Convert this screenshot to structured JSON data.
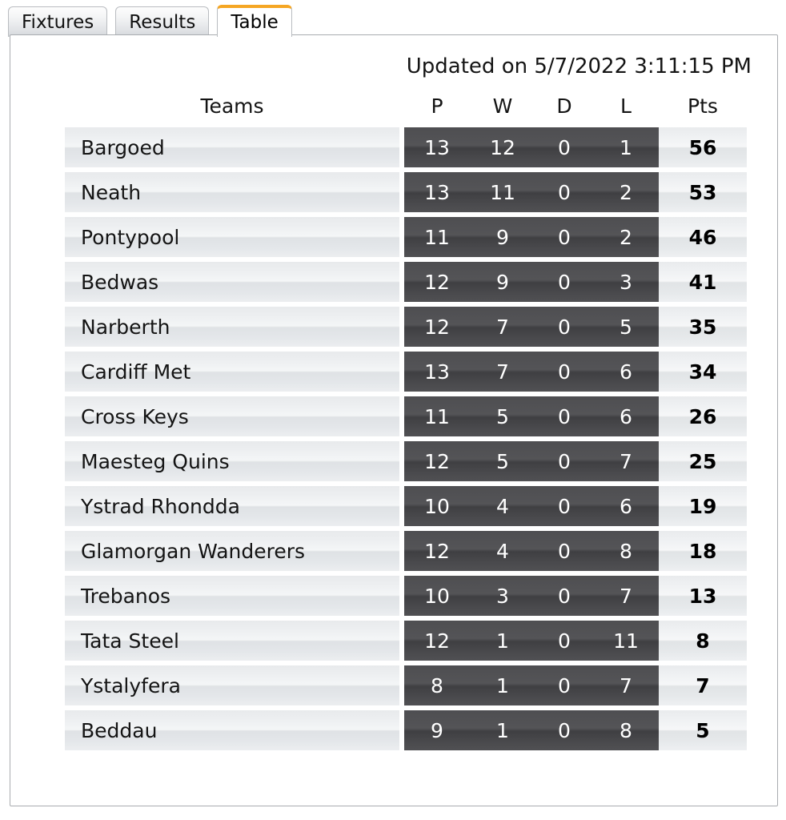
{
  "tabs": [
    {
      "label": "Fixtures",
      "active": false
    },
    {
      "label": "Results",
      "active": false
    },
    {
      "label": "Table",
      "active": true
    }
  ],
  "panel": {
    "updated_text": "Updated on 5/7/2022 3:11:15 PM"
  },
  "table": {
    "headers": {
      "team": "Teams",
      "played": "P",
      "won": "W",
      "drawn": "D",
      "lost": "L",
      "points": "Pts"
    },
    "rows": [
      {
        "team": "Bargoed",
        "p": "13",
        "w": "12",
        "d": "0",
        "l": "1",
        "pts": "56"
      },
      {
        "team": "Neath",
        "p": "13",
        "w": "11",
        "d": "0",
        "l": "2",
        "pts": "53"
      },
      {
        "team": "Pontypool",
        "p": "11",
        "w": "9",
        "d": "0",
        "l": "2",
        "pts": "46"
      },
      {
        "team": "Bedwas",
        "p": "12",
        "w": "9",
        "d": "0",
        "l": "3",
        "pts": "41"
      },
      {
        "team": "Narberth",
        "p": "12",
        "w": "7",
        "d": "0",
        "l": "5",
        "pts": "35"
      },
      {
        "team": "Cardiff Met",
        "p": "13",
        "w": "7",
        "d": "0",
        "l": "6",
        "pts": "34"
      },
      {
        "team": "Cross Keys",
        "p": "11",
        "w": "5",
        "d": "0",
        "l": "6",
        "pts": "26"
      },
      {
        "team": "Maesteg Quins",
        "p": "12",
        "w": "5",
        "d": "0",
        "l": "7",
        "pts": "25"
      },
      {
        "team": "Ystrad Rhondda",
        "p": "10",
        "w": "4",
        "d": "0",
        "l": "6",
        "pts": "19"
      },
      {
        "team": "Glamorgan Wanderers",
        "p": "12",
        "w": "4",
        "d": "0",
        "l": "8",
        "pts": "18"
      },
      {
        "team": "Trebanos",
        "p": "10",
        "w": "3",
        "d": "0",
        "l": "7",
        "pts": "13"
      },
      {
        "team": "Tata Steel",
        "p": "12",
        "w": "1",
        "d": "0",
        "l": "11",
        "pts": "8"
      },
      {
        "team": "Ystalyfera",
        "p": "8",
        "w": "1",
        "d": "0",
        "l": "7",
        "pts": "7"
      },
      {
        "team": "Beddau",
        "p": "9",
        "w": "1",
        "d": "0",
        "l": "8",
        "pts": "5"
      }
    ]
  },
  "colors": {
    "active_tab_accent": "#f5a623",
    "numeric_cell_bg": "#4a4a4d",
    "panel_border": "#a9acb0"
  }
}
